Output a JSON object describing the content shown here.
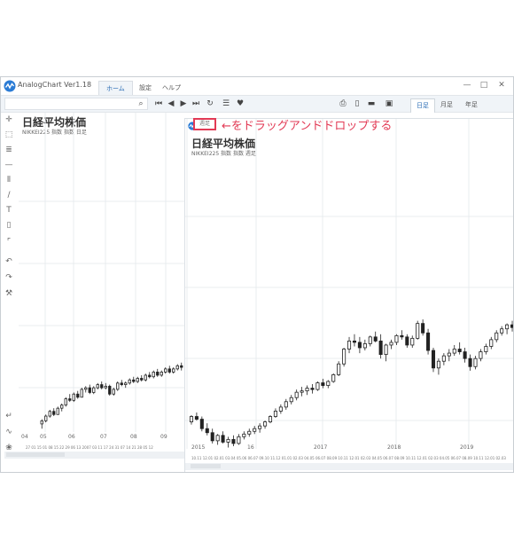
{
  "app": {
    "title": "AnalogChart Ver1.18",
    "menu_tabs": [
      "ホーム",
      "設定",
      "ヘルプ"
    ],
    "window_controls": {
      "minimize": "—",
      "maximize": "□",
      "close": "✕"
    },
    "period_tabs": [
      "日足",
      "月足",
      "年足"
    ],
    "active_period": "日足"
  },
  "annotation": {
    "tab_label": "週足",
    "note": "←をドラッグアンドドロップする",
    "color": "#e23a55"
  },
  "left_panel": {
    "title": "日経平均株価",
    "subtitle": "NIKKEI225 指数 指数 日足",
    "month_labels": [
      "04",
      "05",
      "06",
      "07",
      "08",
      "09"
    ],
    "date_ticks": "27 01 15 01 08 15 22 29 06 13 2007 03 11 17 24 31 07 14 21 28 05 12"
  },
  "right_panel": {
    "title": "日経平均株価",
    "subtitle": "NIKKEI225 指数 指数 週足",
    "year_labels": [
      "2015",
      "16",
      "2017",
      "2018",
      "2019"
    ],
    "date_ticks": "10.11 12.01 02.01 03.04 05.06 06.07 09.10 11.12 01.01 02.03 04.05 06.07 08.09 10.11 12.01 02.03 04.05 06.07 08.09 10.11 12.01 02.03 04.05 06.07 08.09 10.11 12.01 02.03"
  },
  "chart_data": {
    "type": "candlestick",
    "left_series": [
      [
        13.2,
        13.5,
        12.9,
        13.4
      ],
      [
        13.4,
        13.8,
        13.3,
        13.7
      ],
      [
        13.7,
        14.1,
        13.6,
        14.0
      ],
      [
        14.0,
        14.2,
        13.7,
        13.8
      ],
      [
        13.8,
        14.3,
        13.8,
        14.2
      ],
      [
        14.2,
        14.5,
        14.0,
        14.4
      ],
      [
        14.4,
        14.9,
        14.3,
        14.8
      ],
      [
        14.8,
        15.1,
        14.6,
        14.7
      ],
      [
        14.7,
        15.2,
        14.6,
        15.1
      ],
      [
        15.1,
        15.3,
        14.8,
        14.9
      ],
      [
        14.9,
        15.5,
        14.9,
        15.4
      ],
      [
        15.4,
        15.6,
        15.2,
        15.5
      ],
      [
        15.5,
        15.7,
        15.1,
        15.2
      ],
      [
        15.2,
        15.6,
        15.1,
        15.5
      ],
      [
        15.5,
        15.8,
        15.4,
        15.7
      ],
      [
        15.7,
        15.9,
        15.4,
        15.5
      ],
      [
        15.5,
        15.8,
        15.4,
        15.6
      ],
      [
        15.6,
        15.7,
        15.0,
        15.1
      ],
      [
        15.1,
        15.5,
        15.0,
        15.4
      ],
      [
        15.4,
        15.9,
        15.3,
        15.8
      ],
      [
        15.8,
        16.0,
        15.6,
        15.7
      ],
      [
        15.7,
        15.9,
        15.5,
        15.8
      ],
      [
        15.8,
        16.1,
        15.7,
        16.0
      ],
      [
        16.0,
        16.2,
        15.8,
        15.9
      ],
      [
        15.9,
        16.2,
        15.8,
        16.1
      ],
      [
        16.1,
        16.3,
        15.9,
        16.0
      ],
      [
        16.0,
        16.4,
        15.9,
        16.3
      ],
      [
        16.3,
        16.5,
        16.1,
        16.2
      ],
      [
        16.2,
        16.6,
        16.1,
        16.5
      ],
      [
        16.5,
        16.7,
        16.2,
        16.3
      ],
      [
        16.3,
        16.6,
        16.2,
        16.5
      ],
      [
        16.5,
        16.8,
        16.4,
        16.7
      ],
      [
        16.7,
        16.9,
        16.4,
        16.5
      ],
      [
        16.5,
        16.8,
        16.4,
        16.7
      ],
      [
        16.7,
        17.0,
        16.6,
        16.9
      ],
      [
        16.9,
        17.1,
        16.6,
        16.8
      ]
    ],
    "right_series": [
      [
        16.5,
        17.0,
        16.3,
        16.9
      ],
      [
        16.9,
        17.2,
        16.6,
        16.7
      ],
      [
        16.7,
        16.9,
        15.8,
        16.0
      ],
      [
        16.0,
        16.4,
        15.5,
        15.7
      ],
      [
        15.7,
        16.0,
        14.9,
        15.1
      ],
      [
        15.1,
        15.6,
        14.8,
        15.5
      ],
      [
        15.5,
        15.8,
        14.9,
        15.0
      ],
      [
        15.0,
        15.4,
        14.6,
        15.2
      ],
      [
        15.2,
        15.5,
        14.7,
        14.9
      ],
      [
        14.9,
        15.6,
        14.8,
        15.4
      ],
      [
        15.4,
        15.8,
        15.2,
        15.6
      ],
      [
        15.6,
        16.0,
        15.4,
        15.8
      ],
      [
        15.8,
        16.2,
        15.6,
        16.0
      ],
      [
        16.0,
        16.4,
        15.7,
        16.2
      ],
      [
        16.2,
        16.6,
        16.0,
        16.5
      ],
      [
        16.5,
        17.0,
        16.4,
        16.9
      ],
      [
        16.9,
        17.5,
        16.8,
        17.3
      ],
      [
        17.3,
        17.8,
        17.1,
        17.6
      ],
      [
        17.6,
        18.2,
        17.4,
        18.0
      ],
      [
        18.0,
        18.5,
        17.8,
        18.3
      ],
      [
        18.3,
        18.9,
        18.1,
        18.7
      ],
      [
        18.7,
        19.1,
        18.4,
        18.8
      ],
      [
        18.8,
        19.2,
        18.5,
        19.0
      ],
      [
        19.0,
        19.3,
        18.6,
        18.9
      ],
      [
        18.9,
        19.5,
        18.8,
        19.4
      ],
      [
        19.4,
        19.7,
        19.0,
        19.2
      ],
      [
        19.2,
        19.6,
        19.0,
        19.5
      ],
      [
        19.5,
        20.1,
        19.4,
        20.0
      ],
      [
        20.0,
        21.0,
        19.9,
        20.8
      ],
      [
        20.8,
        22.0,
        20.6,
        21.9
      ],
      [
        21.9,
        22.8,
        21.6,
        22.5
      ],
      [
        22.5,
        23.0,
        22.1,
        22.4
      ],
      [
        22.4,
        22.8,
        21.6,
        22.0
      ],
      [
        22.0,
        22.6,
        21.8,
        22.3
      ],
      [
        22.3,
        22.9,
        22.1,
        22.8
      ],
      [
        22.8,
        23.2,
        22.4,
        22.5
      ],
      [
        22.5,
        23.0,
        21.2,
        21.5
      ],
      [
        21.5,
        22.3,
        21.0,
        22.2
      ],
      [
        22.2,
        22.6,
        21.9,
        22.4
      ],
      [
        22.4,
        23.0,
        22.2,
        22.9
      ],
      [
        22.9,
        23.3,
        22.6,
        22.8
      ],
      [
        22.8,
        23.0,
        22.0,
        22.2
      ],
      [
        22.2,
        22.9,
        22.0,
        22.7
      ],
      [
        22.7,
        24.0,
        22.6,
        23.8
      ],
      [
        23.8,
        24.1,
        22.9,
        23.1
      ],
      [
        23.1,
        23.4,
        21.5,
        21.8
      ],
      [
        21.8,
        22.0,
        20.2,
        20.5
      ],
      [
        20.5,
        21.2,
        20.0,
        21.0
      ],
      [
        21.0,
        21.6,
        20.7,
        21.4
      ],
      [
        21.4,
        21.9,
        21.0,
        21.6
      ],
      [
        21.6,
        22.2,
        21.4,
        21.9
      ],
      [
        21.9,
        22.4,
        21.5,
        21.7
      ],
      [
        21.7,
        22.0,
        20.9,
        21.2
      ],
      [
        21.2,
        21.5,
        20.3,
        20.6
      ],
      [
        20.6,
        21.4,
        20.4,
        21.2
      ],
      [
        21.2,
        21.9,
        21.0,
        21.7
      ],
      [
        21.7,
        22.3,
        21.5,
        22.1
      ],
      [
        22.1,
        22.8,
        21.9,
        22.6
      ],
      [
        22.6,
        23.3,
        22.4,
        23.1
      ],
      [
        23.1,
        23.6,
        22.9,
        23.4
      ],
      [
        23.4,
        23.8,
        23.0,
        23.7
      ],
      [
        23.7,
        24.0,
        23.2,
        23.5
      ]
    ],
    "xlabel": "",
    "ylabel": ""
  }
}
